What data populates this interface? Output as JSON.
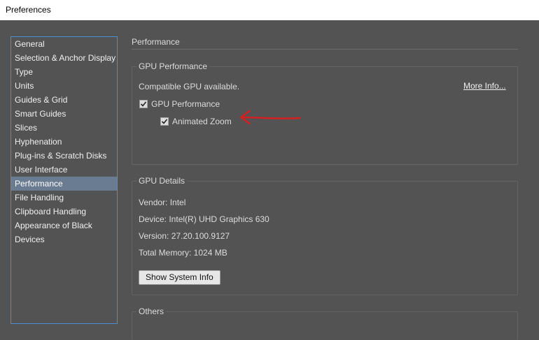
{
  "window": {
    "title": "Preferences"
  },
  "sidebar": {
    "items": [
      {
        "label": "General"
      },
      {
        "label": "Selection & Anchor Display"
      },
      {
        "label": "Type"
      },
      {
        "label": "Units"
      },
      {
        "label": "Guides & Grid"
      },
      {
        "label": "Smart Guides"
      },
      {
        "label": "Slices"
      },
      {
        "label": "Hyphenation"
      },
      {
        "label": "Plug-ins & Scratch Disks"
      },
      {
        "label": "User Interface"
      },
      {
        "label": "Performance"
      },
      {
        "label": "File Handling"
      },
      {
        "label": "Clipboard Handling"
      },
      {
        "label": "Appearance of Black"
      },
      {
        "label": "Devices"
      }
    ],
    "active": "Performance"
  },
  "panel": {
    "title": "Performance",
    "gpu_performance": {
      "legend": "GPU Performance",
      "status": "Compatible GPU available.",
      "more_info": "More Info...",
      "gpu_checkbox_label": "GPU Performance",
      "gpu_checked": true,
      "zoom_checkbox_label": "Animated Zoom",
      "zoom_checked": true
    },
    "gpu_details": {
      "legend": "GPU Details",
      "vendor": "Vendor: Intel",
      "device": "Device: Intel(R) UHD Graphics 630",
      "version": "Version: 27.20.100.9127",
      "memory": "Total Memory: 1024 MB",
      "show_system_info": "Show System Info"
    },
    "others": {
      "legend": "Others"
    }
  },
  "colors": {
    "accent": "#4a8fd8",
    "annotation": "#d42020",
    "background": "#535353"
  }
}
